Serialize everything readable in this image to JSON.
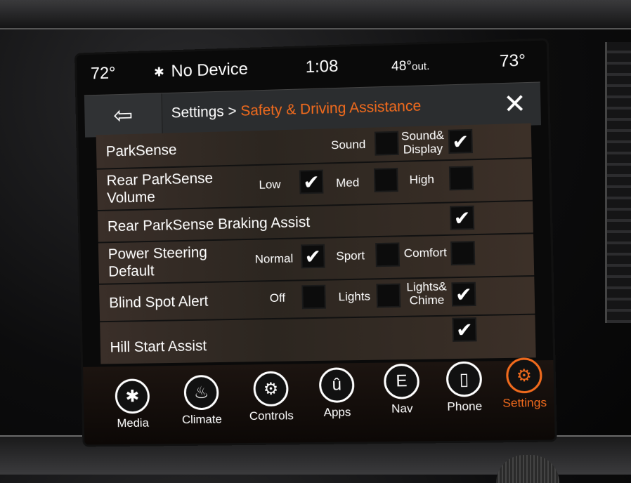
{
  "status_bar": {
    "left_temp": "72°",
    "device": "No Device",
    "time": "1:08",
    "outside_temp": "48°",
    "outside_suffix": "out.",
    "right_temp": "73°",
    "bluetooth_icon": "bluetooth-icon"
  },
  "header": {
    "back_icon": "back-arrow-icon",
    "breadcrumb_root": "Settings",
    "separator": ">",
    "breadcrumb_current": "Safety & Driving Assistance",
    "close_icon": "close-icon",
    "accent_color": "#f26b1d"
  },
  "settings": [
    {
      "label": "ParkSense",
      "options": [
        {
          "label": "Sound",
          "checked": false
        },
        {
          "label": "Sound& Display",
          "checked": true
        }
      ]
    },
    {
      "label": "Rear ParkSense Volume",
      "options": [
        {
          "label": "Low",
          "checked": true
        },
        {
          "label": "Med",
          "checked": false
        },
        {
          "label": "High",
          "checked": false
        }
      ]
    },
    {
      "label": "Rear ParkSense Braking Assist",
      "checked": true
    },
    {
      "label": "Power Steering Default",
      "options": [
        {
          "label": "Normal",
          "checked": true
        },
        {
          "label": "Sport",
          "checked": false
        },
        {
          "label": "Comfort",
          "checked": false
        }
      ]
    },
    {
      "label": "Blind Spot Alert",
      "options": [
        {
          "label": "Off",
          "checked": false
        },
        {
          "label": "Lights",
          "checked": false
        },
        {
          "label": "Lights& Chime",
          "checked": true
        }
      ]
    },
    {
      "label": "Hill Start Assist",
      "checked": true
    }
  ],
  "dock": [
    {
      "label": "Media",
      "icon": "bluetooth-icon",
      "glyph": "✱",
      "active": false
    },
    {
      "label": "Climate",
      "icon": "climate-seat-icon",
      "glyph": "♨",
      "active": false
    },
    {
      "label": "Controls",
      "icon": "controls-seat-icon",
      "glyph": "⚙",
      "active": false
    },
    {
      "label": "Apps",
      "icon": "apps-icon",
      "glyph": "û",
      "active": false
    },
    {
      "label": "Nav",
      "icon": "compass-icon",
      "glyph": "E",
      "active": false
    },
    {
      "label": "Phone",
      "icon": "phone-icon",
      "glyph": "▯",
      "active": false
    },
    {
      "label": "Settings",
      "icon": "settings-gear-icon",
      "glyph": "⚙",
      "active": true
    }
  ]
}
